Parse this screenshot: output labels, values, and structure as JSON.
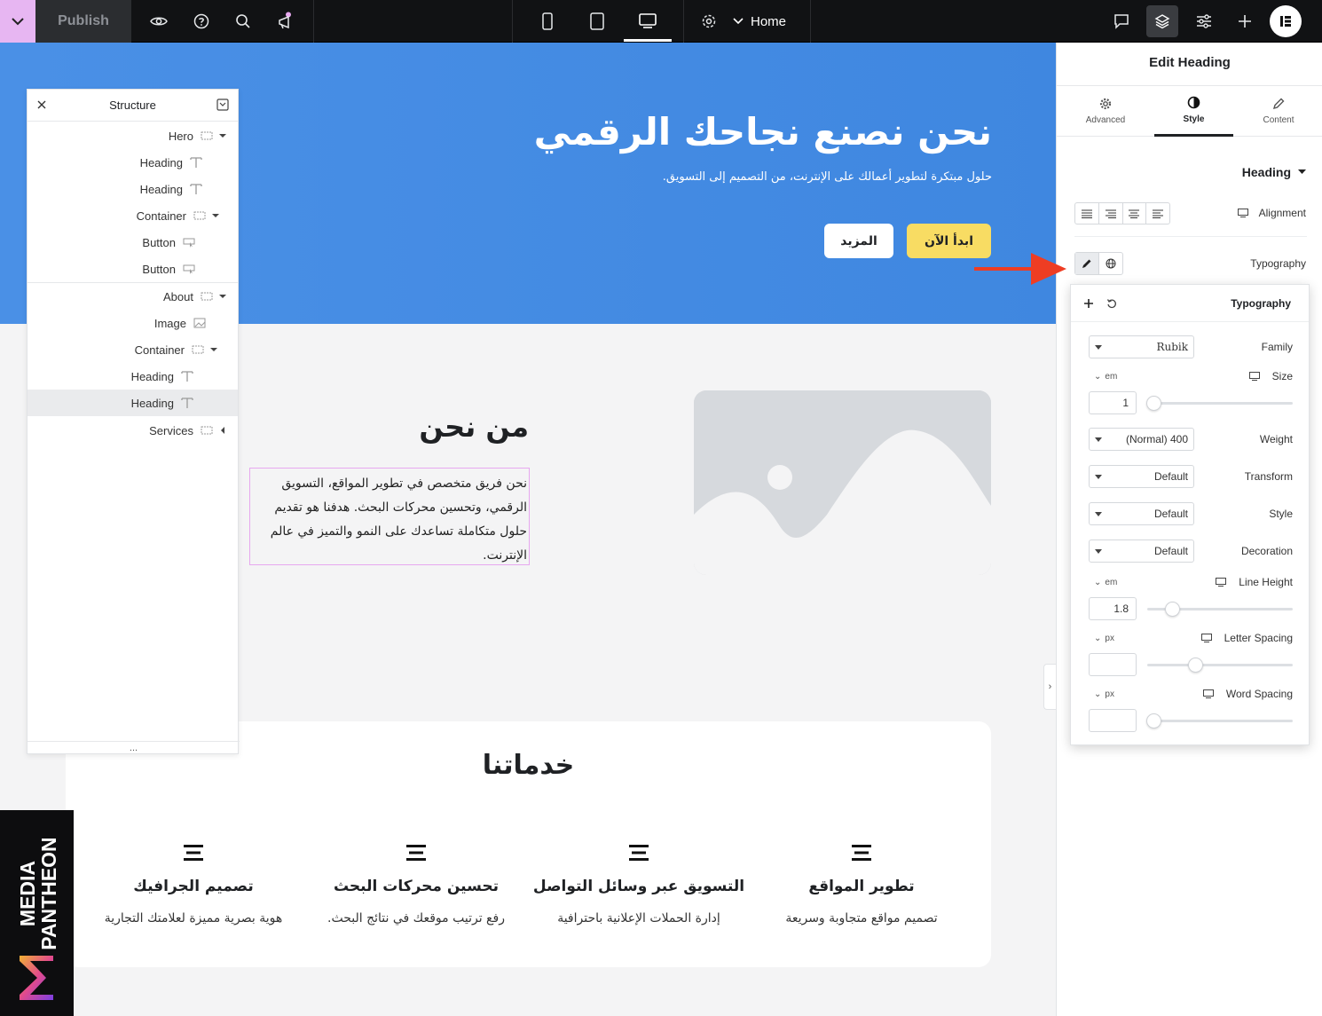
{
  "topbar": {
    "publish_label": "Publish",
    "page_label": "Home",
    "icons": [
      "chevron-down-icon",
      "eye-icon",
      "help-icon",
      "search-icon",
      "megaphone-icon",
      "mobile-icon",
      "tablet-icon",
      "desktop-icon",
      "settings-icon",
      "comments-icon",
      "layers-icon",
      "sliders-icon",
      "plus-icon",
      "elementor-logo-icon"
    ]
  },
  "hero": {
    "title": "نحن نصنع نجاحك الرقمي",
    "subtitle": "حلول مبتكرة لتطوير أعمالك على الإنترنت، من التصميم إلى التسويق.",
    "primary_button": "ابدأ الآن",
    "secondary_button": "المزيد",
    "bg_color": "#4a90e6",
    "accent_button_color": "#f8dc63"
  },
  "about": {
    "title": "من نحن",
    "text": "نحن فريق متخصص في تطوير المواقع، التسويق الرقمي، وتحسين محركات البحث. هدفنا هو تقديم حلول متكاملة تساعدك على النمو والتميز في عالم الإنترنت."
  },
  "services": {
    "title": "خدماتنا",
    "items": [
      {
        "title": "تطوير المواقع",
        "desc": "تصميم مواقع متجاوبة وسريعة"
      },
      {
        "title": "التسويق عبر وسائل التواصل",
        "desc": "إدارة الحملات الإعلانية باحترافية"
      },
      {
        "title": "تحسين محركات البحث",
        "desc": "رفع ترتيب موقعك في نتائج البحث."
      },
      {
        "title": "تصميم الجرافيك",
        "desc": "هوية بصرية مميزة لعلامتك التجارية"
      }
    ]
  },
  "watermark": {
    "line1": "MEDIA",
    "line2": "PANTHEON"
  },
  "structure": {
    "title": "Structure",
    "items": [
      {
        "label": "Hero",
        "icon": "container-icon",
        "arrow": "down"
      },
      {
        "label": "Heading",
        "icon": "heading-icon"
      },
      {
        "label": "Heading",
        "icon": "heading-icon"
      },
      {
        "label": "Container",
        "icon": "container-icon",
        "arrow": "down"
      },
      {
        "label": "Button",
        "icon": "button-icon"
      },
      {
        "label": "Button",
        "icon": "button-icon"
      },
      {
        "label": "About",
        "icon": "container-icon",
        "arrow": "down"
      },
      {
        "label": "Image",
        "icon": "image-icon"
      },
      {
        "label": "Container",
        "icon": "container-icon",
        "arrow": "down"
      },
      {
        "label": "Heading",
        "icon": "heading-icon"
      },
      {
        "label": "Heading",
        "icon": "heading-icon",
        "selected": true
      },
      {
        "label": "Services",
        "icon": "container-icon",
        "arrow": "left"
      }
    ],
    "footer": "..."
  },
  "panel": {
    "title": "Edit Heading",
    "tabs": [
      {
        "label": "Advanced",
        "icon": "gear-icon"
      },
      {
        "label": "Style",
        "icon": "contrast-icon",
        "active": true
      },
      {
        "label": "Content",
        "icon": "pencil-icon"
      }
    ],
    "section": "Heading",
    "alignment_label": "Alignment",
    "typography_label": "Typography",
    "popover": {
      "title": "Typography",
      "family_label": "Family",
      "family_value": "Rubik",
      "size_label": "Size",
      "size_unit": "em",
      "size_value": "1",
      "weight_label": "Weight",
      "weight_value": "(Normal) 400",
      "transform_label": "Transform",
      "transform_value": "Default",
      "style_label": "Style",
      "style_value": "Default",
      "decoration_label": "Decoration",
      "decoration_value": "Default",
      "line_height_label": "Line Height",
      "line_height_unit": "em",
      "line_height_value": "1.8",
      "letter_spacing_label": "Letter Spacing",
      "letter_spacing_unit": "px",
      "letter_spacing_value": "",
      "word_spacing_label": "Word Spacing",
      "word_spacing_unit": "px",
      "word_spacing_value": ""
    }
  }
}
